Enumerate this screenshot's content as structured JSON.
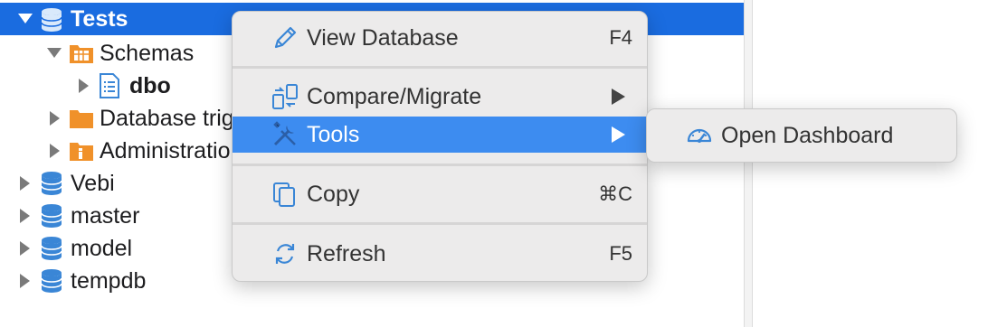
{
  "tree": {
    "items": [
      {
        "label": "Tests",
        "icon": "database-icon",
        "expanded": true,
        "selected": true
      },
      {
        "label": "Schemas",
        "icon": "schemas-folder-icon",
        "expanded": true
      },
      {
        "label": "dbo",
        "icon": "schema-doc-icon",
        "expanded": false
      },
      {
        "label": "Database triggers",
        "icon": "folder-icon",
        "expanded": false
      },
      {
        "label": "Administration",
        "icon": "admin-folder-icon",
        "expanded": false
      },
      {
        "label": "Vebi",
        "icon": "database-icon",
        "expanded": false
      },
      {
        "label": "master",
        "icon": "database-icon",
        "expanded": false
      },
      {
        "label": "model",
        "icon": "database-icon",
        "expanded": false
      },
      {
        "label": "tempdb",
        "icon": "database-icon",
        "expanded": false
      }
    ]
  },
  "context_menu": {
    "items": [
      {
        "label": "View Database",
        "shortcut": "F4",
        "icon": "pencil-icon"
      },
      {
        "label": "Compare/Migrate",
        "icon": "compare-icon",
        "submenu": true
      },
      {
        "label": "Tools",
        "icon": "tools-icon",
        "submenu": true,
        "highlighted": true
      },
      {
        "label": "Copy",
        "shortcut": "⌘C",
        "icon": "copy-icon"
      },
      {
        "label": "Refresh",
        "shortcut": "F5",
        "icon": "refresh-icon"
      }
    ]
  },
  "submenu": {
    "items": [
      {
        "label": "Open Dashboard",
        "icon": "dashboard-gauge-icon"
      }
    ]
  },
  "colors": {
    "selection": "#1a6ce0",
    "menu_highlight": "#3d8cf0",
    "db_icon": "#3a86d6",
    "folder": "#f0912a"
  }
}
